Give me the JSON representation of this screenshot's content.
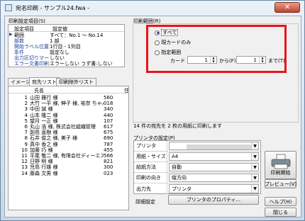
{
  "window": {
    "title": "宛名印刷 - サンプル24.fwa -",
    "close_label": "✕"
  },
  "settings": {
    "group_label": "印刷設定項目(S)",
    "header_item": "設定項目",
    "header_value": "設定値",
    "rows": [
      {
        "key": "範囲",
        "value": "すべて：No.1 〜 No.14"
      },
      {
        "key": "部数",
        "value": "1 部"
      },
      {
        "key": "開始ラベル位置",
        "value": "1行目 - 1列目"
      },
      {
        "key": "条件",
        "value": "設定なし"
      },
      {
        "key": "出力区切りマーク",
        "value": "しない"
      },
      {
        "key": "エラー文書印刷",
        "value": "エラーしない うず書:しない"
      }
    ]
  },
  "range": {
    "group_label": "印刷範囲(R)",
    "options": [
      "すべて",
      "現カードのみ",
      "指定範囲"
    ],
    "selected_index": 0,
    "card_label": "カード",
    "from_value": "1",
    "from_label": "から(F)",
    "to_value": "1",
    "to_label": "まで(T)"
  },
  "tabs": [
    "イメージ",
    "宛先リスト",
    "印刷除外リスト"
  ],
  "active_tab": 1,
  "list": {
    "col_name": "氏名",
    "col_zip": "住所",
    "rows": [
      {
        "no": "1",
        "name": "山田 雅行 様",
        "zip": "560"
      },
      {
        "no": "2",
        "name": "大竹 一平 様, 伸子 様, 祐奈 ちゃん",
        "zip": "018"
      },
      {
        "no": "3",
        "name": "中田 誠 様",
        "zip": "340"
      },
      {
        "no": "4",
        "name": "山本 隆二 様",
        "zip": "440"
      },
      {
        "no": "5",
        "name": "望月 一正 様",
        "zip": "107"
      },
      {
        "no": "6",
        "name": "丸山 浩 様, 株式会社組織管理",
        "zip": "617"
      },
      {
        "no": "7",
        "name": "副島 直樹 様",
        "zip": "675"
      },
      {
        "no": "8",
        "name": "石井 俊之 様, 美子 様",
        "zip": "690"
      },
      {
        "no": "9",
        "name": "真中 香之 様",
        "zip": "787"
      },
      {
        "no": "10",
        "name": "加藤 巧 様",
        "zip": "455"
      },
      {
        "no": "11",
        "name": "平尾 敬二 様, 有限会社ディーエス",
        "zip": "566"
      },
      {
        "no": "12",
        "name": "日野 明 様",
        "zip": "821"
      },
      {
        "no": "13",
        "name": "児島 行雄 様",
        "zip": "300"
      },
      {
        "no": "14",
        "name": "藤森 文男 様",
        "zip": "023"
      }
    ]
  },
  "summary": "14 件の宛先を 2 枚の用紙に印刷します",
  "printer": {
    "group_label": "プリンタの設定(P)",
    "rows": [
      {
        "key": "プリンタ",
        "value": ""
      },
      {
        "key": "用紙・サイズ",
        "value": "A4"
      },
      {
        "key": "給紙方法",
        "value": "自動"
      },
      {
        "key": "印刷の向き",
        "value": "縦方向"
      },
      {
        "key": "出力先",
        "value": "プリンタ"
      }
    ],
    "detail_label": "詳細設定",
    "properties_button": "プリンタのプロパティ..."
  },
  "buttons": {
    "print": "印刷開始",
    "preview": "プレビュー(V)",
    "help": "ヘルプ(H)",
    "close": "閉じる"
  },
  "colors": {
    "highlight": "#e8141b",
    "link": "#1a3f9b"
  }
}
